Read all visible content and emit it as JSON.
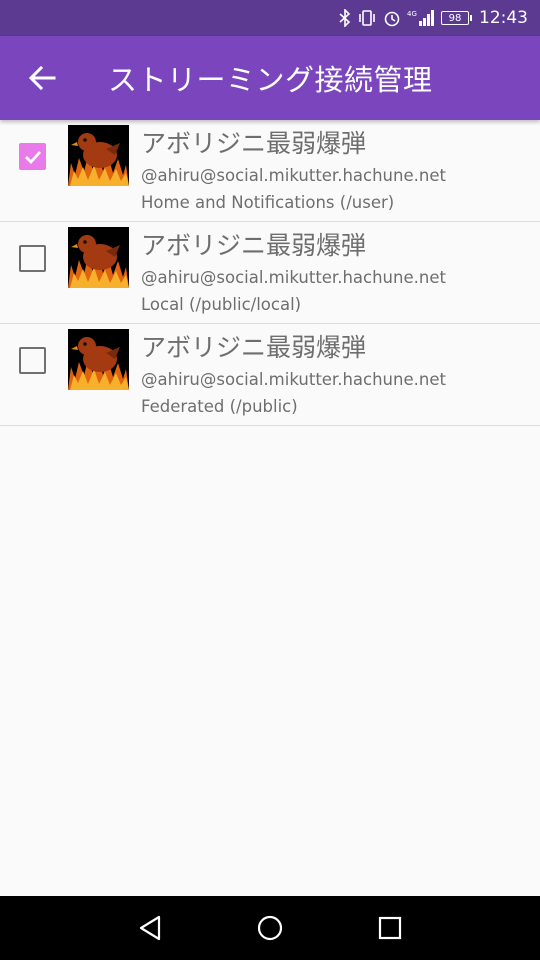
{
  "status_bar": {
    "time": "12:43",
    "battery": "98",
    "network": "4G",
    "icons": [
      "bluetooth-icon",
      "vibrate-icon",
      "alarm-icon",
      "signal-icon",
      "battery-icon"
    ]
  },
  "app_bar": {
    "title": "ストリーミング接続管理",
    "back_icon": "arrow-back-icon",
    "color": "#7b45bd"
  },
  "streams": [
    {
      "checked": true,
      "name": "アボリジニ最弱爆弾",
      "account": "@ahiru@social.mikutter.hachune.net",
      "stream": "Home and Notifications (/user)"
    },
    {
      "checked": false,
      "name": "アボリジニ最弱爆弾",
      "account": "@ahiru@social.mikutter.hachune.net",
      "stream": "Local (/public/local)"
    },
    {
      "checked": false,
      "name": "アボリジニ最弱爆弾",
      "account": "@ahiru@social.mikutter.hachune.net",
      "stream": "Federated (/public)"
    }
  ],
  "nav_bar": {
    "icons": [
      "back-triangle-icon",
      "home-circle-icon",
      "recents-square-icon"
    ]
  },
  "colors": {
    "status_bar": "#5c3a92",
    "checkbox_checked": "#e97ae9",
    "text": "#6e6e6e",
    "background": "#fafafa"
  }
}
